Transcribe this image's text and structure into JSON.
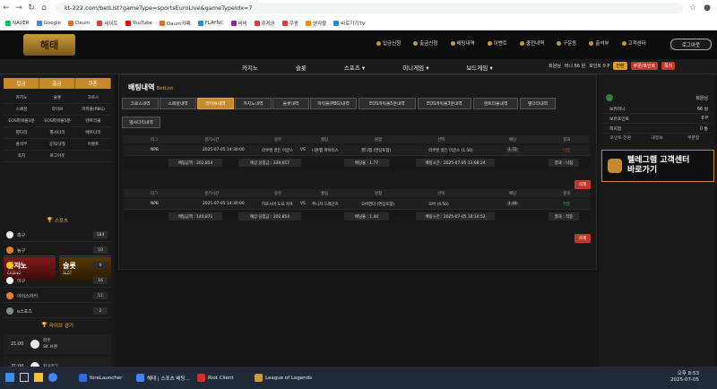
{
  "browser": {
    "url": "kt-222.com/betList?gameType=sportsEuroLive&gameTypeIdx=7",
    "bookmarks": [
      {
        "label": "NAVER",
        "color": "#03c75a"
      },
      {
        "label": "Google",
        "color": "#4285f4"
      },
      {
        "label": "Daum",
        "color": "#f26522"
      },
      {
        "label": "네이트",
        "color": "#e53935"
      },
      {
        "label": "YouTube",
        "color": "#ff0000"
      },
      {
        "label": "Daum카페",
        "color": "#f26522"
      },
      {
        "label": "FLAYNC",
        "color": "#1e88e5"
      },
      {
        "label": "비비",
        "color": "#8e24aa"
      },
      {
        "label": "휴게공",
        "color": "#e53935"
      },
      {
        "label": "쿠팡",
        "color": "#e53935"
      },
      {
        "label": "생각블",
        "color": "#fb8c00"
      },
      {
        "label": "바로가기TV",
        "color": "#1e88e5"
      }
    ]
  },
  "site": {
    "logo": "해태",
    "top_links": [
      "입금신청",
      "출금신청",
      "배팅내역",
      "이벤트",
      "충전내역",
      "구운동",
      "출석부",
      "고객센터"
    ],
    "logout": "로그아웃",
    "nav": [
      "카지노",
      "슬롯",
      "스포츠 ▾",
      "미니게임 ▾",
      "보드게임 ▾"
    ],
    "userbar": {
      "user": "회원님",
      "money": "머니 66 원",
      "point": "포인트 0 P",
      "btn1": "전환",
      "btn2": "쿠폰/포인트",
      "btn3": "쪽지"
    }
  },
  "sidebar": {
    "top": [
      "입금",
      "출금",
      "쿠폰"
    ],
    "grid": [
      "카지노",
      "슬롯",
      "크로스",
      "스페셜",
      "라이브",
      "파워볼(PBG)",
      "EOS파워볼3분",
      "EOS파워볼5분",
      "엔트리볼",
      "별다리",
      "별사다리",
      "베트다리",
      "출석부",
      "공지/규정",
      "이벤트",
      "쪽지",
      "로그아웃",
      ""
    ],
    "promo": [
      {
        "title": "카지노",
        "sub": "CASINO"
      },
      {
        "title": "슬롯",
        "sub": "SLOT"
      }
    ],
    "sports_title": "스포츠",
    "sports": [
      {
        "name": "축구",
        "count": "184",
        "color": "#eeeeee"
      },
      {
        "name": "농구",
        "count": "10",
        "color": "#e67e22"
      },
      {
        "name": "배구",
        "count": "9",
        "color": "#f1c40f"
      },
      {
        "name": "야구",
        "count": "16",
        "color": "#ffffff"
      },
      {
        "name": "아이스하키",
        "count": "11",
        "color": "#e67e22"
      },
      {
        "name": "e스포츠",
        "count": "2",
        "color": "#7f8c8d"
      }
    ],
    "live_title": "라이브 경기",
    "live": [
      {
        "time": "21:00",
        "team1": "파주",
        "team2": "SK 브랜"
      },
      {
        "time": "21:00",
        "team1": "지구리그",
        "team2": ""
      }
    ]
  },
  "content": {
    "title": "배팅내역",
    "title_sub": "BetList",
    "tabs": [
      "크로스내역",
      "스페셜내역",
      "라이브내역",
      "카지노내역",
      "슬롯내역",
      "파워볼(PBG)내역",
      "EOS파워볼5분내역",
      "EOS파워볼3분내역",
      "엔트리볼내역",
      "별다리내역",
      "별사다리내역"
    ],
    "columns": [
      "리그",
      "경기시간",
      "승무",
      "홈팀",
      "원정",
      "선택",
      "배당",
      "결과"
    ],
    "bets": [
      {
        "league": "NPB",
        "time": "2025-07-05 14:30:00",
        "home": "라쿠텐 골든 이글스",
        "vs": "VS",
        "away": "니혼햄 파이터스",
        "market": "핸디캡 (연장포함)",
        "pick": "라쿠텐 골든 이글스 (1.50)",
        "odds": "1.72",
        "result": "낙첨",
        "info": {
          "amount": "배팅금액 : 202,854",
          "expected": "예상 당첨금 : 339,657",
          "odds": "배당율 : 1.77",
          "bet_time": "배팅시간 : 2025-07-05 11:08:24",
          "result": "결과 : 낙첨"
        }
      },
      {
        "league": "NPB",
        "time": "2025-07-05 14:30:00",
        "home": "히로시마 도요 카프",
        "vs": "VS",
        "away": "주니치 드래곤즈",
        "market": "오버언더 (연장포함)",
        "pick": "오버 (4.50)",
        "odds": "1.44",
        "result": "적중",
        "info": {
          "amount": "배팅금액 : 140,871",
          "expected": "예상 당첨금 : 202,854",
          "odds": "배당율 : 1.44",
          "bet_time": "배팅시간 : 2025-07-05 10:14:52",
          "result": "결과 : 적중"
        }
      }
    ],
    "delete": "삭제"
  },
  "rpanel": {
    "user": "회원님",
    "rows": [
      {
        "label": "보유머니",
        "value": "66 원"
      },
      {
        "label": "보유포인트",
        "value": "0 P"
      },
      {
        "label": "쪽지함",
        "value": "0 통"
      }
    ],
    "tabs": [
      "포인트 전환",
      "내정보",
      "쿠폰함"
    ],
    "banner_line1": "텔레그램 고객센터",
    "banner_line2": "바로가기"
  },
  "taskbar": {
    "apps": [
      {
        "label": "foreLauncher",
        "color": "#2d6cdf"
      },
      {
        "label": "해태 | 스포츠 배팅...",
        "color": "#4285f4"
      },
      {
        "label": "Riot Client",
        "color": "#d32f2f"
      },
      {
        "label": "League of Legends",
        "color": "#c89b3c"
      }
    ],
    "time": "오후 8:53",
    "date": "2025-07-05"
  }
}
